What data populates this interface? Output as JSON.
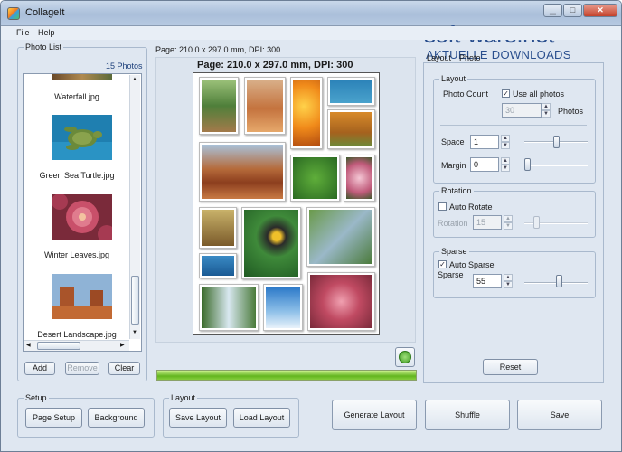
{
  "window": {
    "title": "CollageIt"
  },
  "watermark": {
    "main": "soft-ware.net",
    "sub": "AKTUELLE DOWNLOADS"
  },
  "menu": {
    "file": "File",
    "help": "Help"
  },
  "photo_list": {
    "title": "Photo List",
    "count": "15 Photos",
    "items": [
      "Waterfall.jpg",
      "Green Sea Turtle.jpg",
      "Winter Leaves.jpg",
      "Desert Landscape.jpg"
    ],
    "add": "Add",
    "remove": "Remove",
    "clear": "Clear"
  },
  "page": {
    "header_small": "Page: 210.0 x 297.0 mm, DPI: 300",
    "header_large": "Page: 210.0 x 297.0 mm, DPI: 300"
  },
  "tabs": {
    "layout": "Layout",
    "photo": "Photo"
  },
  "layout_group": {
    "title": "Layout",
    "photo_count_label": "Photo Count",
    "use_all_label": "Use all photos",
    "use_all_checked": true,
    "photos_value": "30",
    "photos_unit": "Photos",
    "space_label": "Space",
    "space_value": "1",
    "margin_label": "Margin",
    "margin_value": "0"
  },
  "rotation_group": {
    "title": "Rotation",
    "auto_rotate_label": "Auto Rotate",
    "auto_rotate_checked": false,
    "rotation_label": "Rotation",
    "rotation_value": "15"
  },
  "sparse_group": {
    "title": "Sparse",
    "auto_sparse_label": "Auto Sparse",
    "auto_sparse_checked": true,
    "sparse_label": "Sparse",
    "sparse_value": "55"
  },
  "reset": "Reset",
  "setup_group": {
    "title": "Setup",
    "page_setup": "Page Setup",
    "background": "Background"
  },
  "layout_bottom_group": {
    "title": "Layout",
    "save_layout": "Save Layout",
    "load_layout": "Load Layout"
  },
  "actions": {
    "generate": "Generate Layout",
    "shuffle": "Shuffle",
    "save": "Save"
  },
  "colors": {
    "progress": "#63b51f",
    "title_bar": "#b6c9e1",
    "accent": "#2a4f8e"
  }
}
